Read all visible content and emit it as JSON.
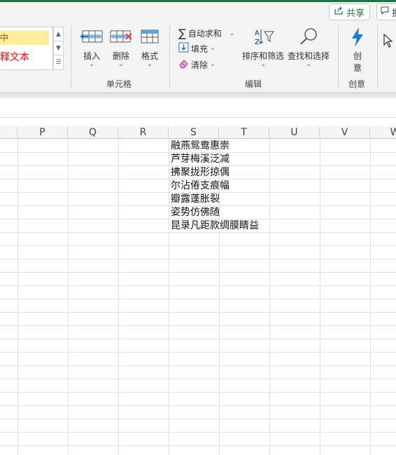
{
  "header": {
    "share_label": "共享",
    "comment_label": "批"
  },
  "styles_gallery": {
    "item1": "中",
    "item2": "释文本"
  },
  "cells_group": {
    "insert_label": "插入",
    "delete_label": "删除",
    "format_label": "格式",
    "group_label": "单元格"
  },
  "editing_group": {
    "autosum_label": "自动求和",
    "fill_label": "填充",
    "clear_label": "清除",
    "sort_filter_label": "排序和筛选",
    "find_select_label": "查找和选择",
    "group_label": "编辑"
  },
  "ideas_group": {
    "ideas_label_1": "创",
    "ideas_label_2": "意",
    "group_label": "创意"
  },
  "sheet": {
    "columns": [
      "P",
      "Q",
      "R",
      "S",
      "T",
      "U",
      "V",
      "W"
    ],
    "rows": [
      "融燕鸳鸯惠崇",
      "芦芽梅溪泛减",
      "拂聚拢形掠偶",
      "尔沾倦支痕幅",
      "瓣露蓬胀裂",
      "姿势仿佛随",
      "昆录凡距款绸膜睛益"
    ]
  },
  "colors": {
    "accent": "#217346",
    "ideas_blue": "#1e7bd2",
    "neutral_style_bg": "#ffeb9c",
    "explanatory_red": "#ff0000"
  }
}
